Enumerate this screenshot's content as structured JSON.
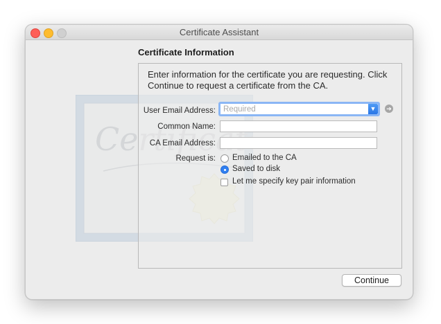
{
  "window": {
    "title": "Certificate Assistant"
  },
  "section": {
    "heading": "Certificate Information",
    "intro": "Enter information for the certificate you are requesting. Click Continue to request a certificate from the CA."
  },
  "form": {
    "user_email_label": "User Email Address:",
    "user_email_value": "",
    "user_email_placeholder": "Required",
    "common_name_label": "Common Name:",
    "common_name_value": "",
    "ca_email_label": "CA Email Address:",
    "ca_email_value": "",
    "request_label": "Request is:",
    "options": {
      "emailed": "Emailed to the CA",
      "saved": "Saved to disk",
      "specify_key": "Let me specify key pair information"
    },
    "selected_option": "saved",
    "specify_key_checked": false
  },
  "buttons": {
    "continue": "Continue"
  },
  "artwork": {
    "script_text": "Certificate"
  },
  "colors": {
    "accent": "#2f7ff1",
    "focus_ring": "#8ab6f5",
    "close": "#fe5f57",
    "minimize": "#febc2e",
    "zoom_disabled": "#d0d0d0"
  },
  "icons": {
    "dropdown": "chevron-down-icon",
    "info": "back-arrow-icon"
  }
}
